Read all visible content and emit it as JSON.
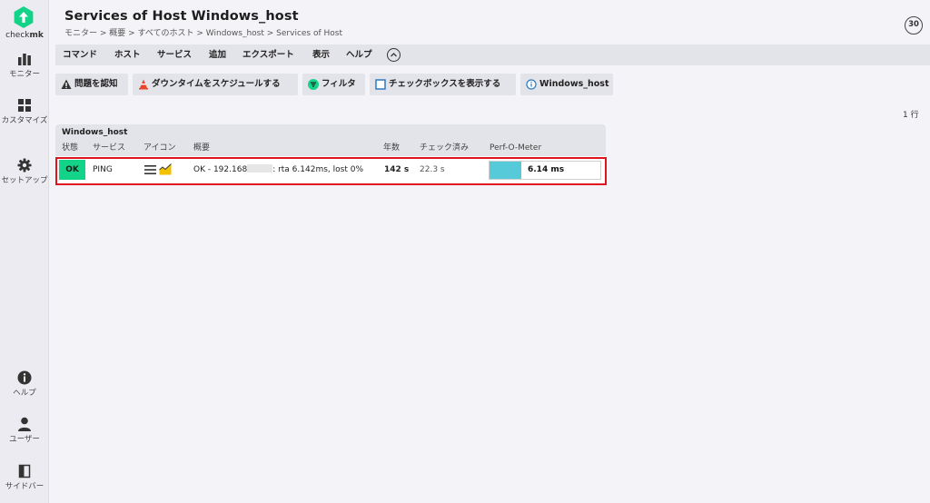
{
  "brand": {
    "name_prefix": "check",
    "name_suffix": "mk",
    "logo_color": "#13d389"
  },
  "sidebar": {
    "items": [
      {
        "label": "モニター",
        "icon": "bar-chart-icon"
      },
      {
        "label": "カスタマイズ",
        "icon": "grid-icon"
      },
      {
        "label": "セットアップ",
        "icon": "gear-icon"
      },
      {
        "label": "ヘルプ",
        "icon": "info-icon"
      },
      {
        "label": "ユーザー",
        "icon": "user-icon"
      },
      {
        "label": "サイドバー",
        "icon": "sidebar-icon"
      }
    ]
  },
  "header": {
    "title": "Services of Host Windows_host",
    "breadcrumb": "モニター > 概要 > すべてのホスト > Windows_host > Services of Host",
    "refresh_seconds": "30"
  },
  "menu": {
    "items": [
      "コマンド",
      "ホスト",
      "サービス",
      "追加",
      "エクスポート",
      "表示",
      "ヘルプ"
    ]
  },
  "actions": {
    "acknowledge": "問題を認知",
    "schedule_downtime": "ダウンタイムをスケジュールする",
    "filter": "フィルタ",
    "show_checkboxes": "チェックボックスを表示する",
    "host_link": "Windows_host"
  },
  "row_count": "1 行",
  "table": {
    "group_title": "Windows_host",
    "columns": [
      "状態",
      "サービス",
      "アイコン",
      "概要",
      "年数",
      "チェック済み",
      "Perf-O-Meter"
    ],
    "rows": [
      {
        "state": "OK",
        "service": "PING",
        "summary_prefix": "OK - 192.168",
        "summary_suffix": ": rta 6.142ms, lost 0%",
        "age": "142 s",
        "checked": "22.3 s",
        "perf_label": "6.14 ms",
        "perf_fraction": 0.29
      }
    ]
  },
  "colors": {
    "ok": "#13d389",
    "perf_bar": "#57cad9",
    "highlight": "#e0141e"
  }
}
